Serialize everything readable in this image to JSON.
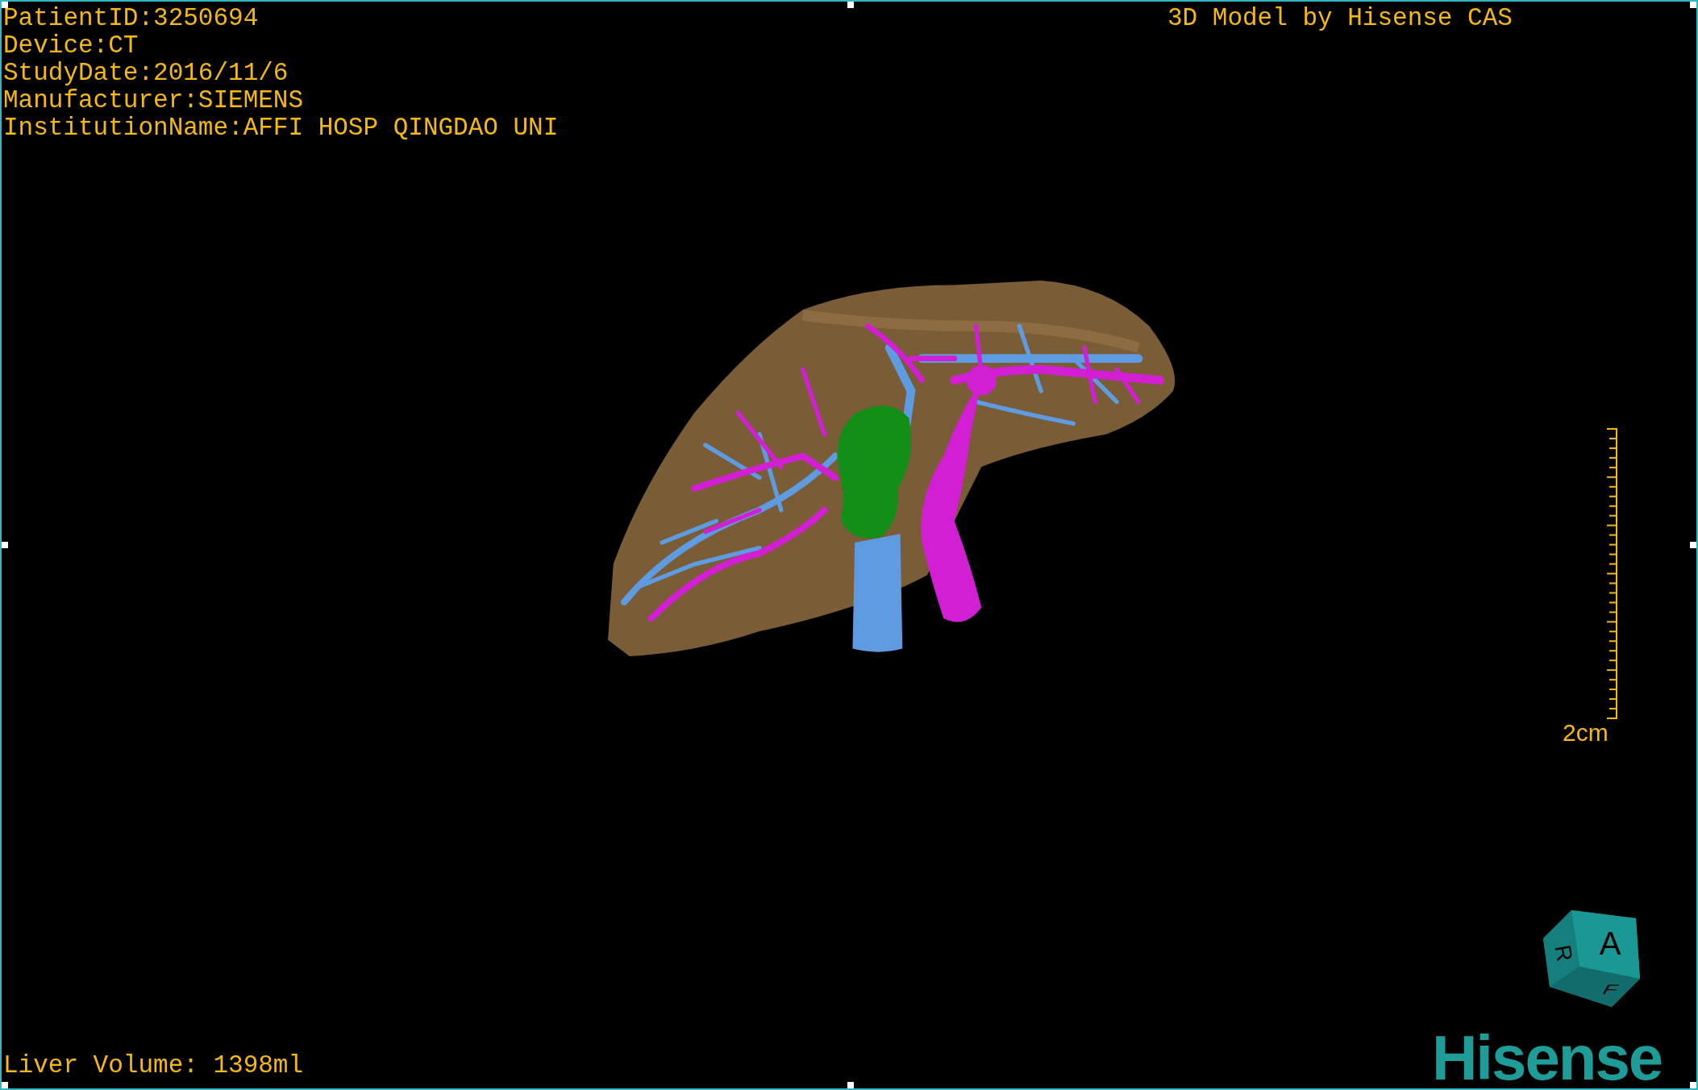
{
  "overlay": {
    "info_lines": [
      "PatientID:3250694",
      "Device:CT",
      "StudyDate:2016/11/6",
      "Manufacturer:SIEMENS",
      "InstitutionName:AFFI HOSP QINGDAO UNI"
    ],
    "credit": "3D Model by Hisense CAS",
    "volume": "Liver Volume: 1398ml"
  },
  "scale_bar": {
    "label": "2cm"
  },
  "orientation_cube": {
    "faces": [
      {
        "kind": "front",
        "label": "A"
      },
      {
        "kind": "side",
        "label": "R"
      },
      {
        "kind": "bottom",
        "label": "F"
      }
    ]
  },
  "logo": "Hisense"
}
